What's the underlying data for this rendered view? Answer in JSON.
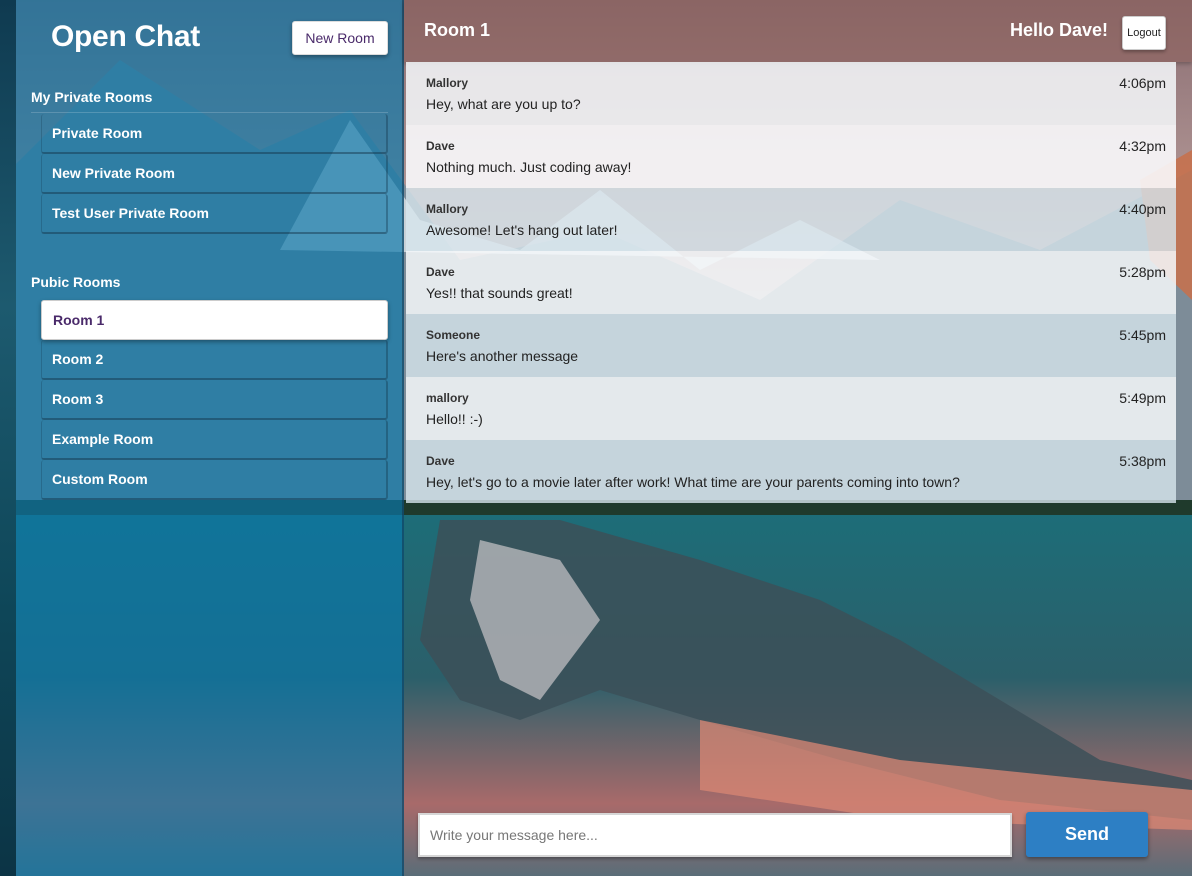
{
  "app": {
    "title": "Open Chat",
    "new_room_label": "New Room"
  },
  "sidebar": {
    "private_title": "My Private Rooms",
    "private_rooms": [
      "Private Room",
      "New Private Room",
      "Test User Private Room"
    ],
    "public_title": "Pubic Rooms",
    "public_rooms": [
      "Room 1",
      "Room 2",
      "Room 3",
      "Example Room",
      "Custom Room"
    ],
    "active_room": "Room 1"
  },
  "header": {
    "room_title": "Room 1",
    "greeting": "Hello Dave!",
    "logout_label": "Logout"
  },
  "messages": [
    {
      "author": "Mallory",
      "text": "Hey, what are you up to?",
      "time": "4:06pm"
    },
    {
      "author": "Dave",
      "text": "Nothing much. Just coding away!",
      "time": "4:32pm"
    },
    {
      "author": "Mallory",
      "text": "Awesome! Let's hang out later!",
      "time": "4:40pm"
    },
    {
      "author": "Dave",
      "text": "Yes!! that sounds great!",
      "time": "5:28pm"
    },
    {
      "author": "Someone",
      "text": "Here's another message",
      "time": "5:45pm"
    },
    {
      "author": "mallory",
      "text": "Hello!! :-)",
      "time": "5:49pm"
    },
    {
      "author": "Dave",
      "text": "Hey, let's go to a movie later after work! What time are your parents coming into town?",
      "time": "5:38pm"
    }
  ],
  "composer": {
    "placeholder": "Write your message here...",
    "send_label": "Send"
  },
  "colors": {
    "sidebar": "#0a78aa",
    "accent_text": "#4a2a6a",
    "send_button": "#2d7fc4"
  }
}
